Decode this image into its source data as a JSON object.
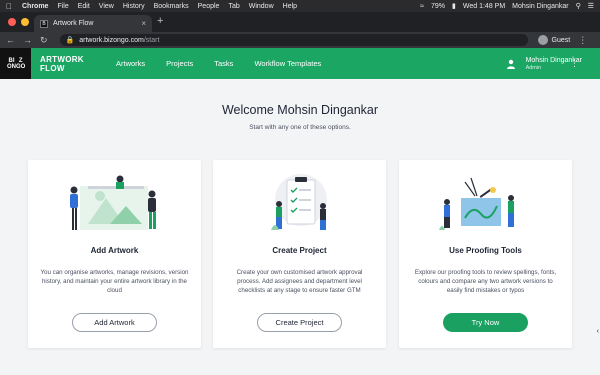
{
  "mac_menu": {
    "app": "Chrome",
    "items": [
      "File",
      "Edit",
      "View",
      "History",
      "Bookmarks",
      "People",
      "Tab",
      "Window",
      "Help"
    ],
    "battery": "79%",
    "clock": "Wed 1:48 PM",
    "user": "Mohsin Dingankar"
  },
  "browser": {
    "tab_title": "Artwork Flow",
    "url_host": "artwork.bizongo.com",
    "url_path": "/start",
    "profile": "Guest"
  },
  "app": {
    "logo_letters": [
      "BI",
      "Z",
      "ON",
      "GO"
    ],
    "name_line1": "ARTWORK",
    "name_line2": "FLOW",
    "nav": [
      "Artworks",
      "Projects",
      "Tasks",
      "Workflow Templates"
    ],
    "user_name": "Mohsin Dingankar",
    "user_role": "Admin",
    "brand_color": "#1ba664"
  },
  "page": {
    "welcome": "Welcome Mohsin Dingankar",
    "subtitle": "Start with any one of these options."
  },
  "cards": [
    {
      "title": "Add Artwork",
      "description": "You can organise artworks, manage revisions, version history, and maintain your entire artwork library in the cloud",
      "button": "Add Artwork",
      "illustration": "artwork-illustration-icon"
    },
    {
      "title": "Create Project",
      "description": "Create your own customised artwork approval process. Add assignees and department level checklists at any stage to ensure faster GTM",
      "button": "Create Project",
      "illustration": "checklist-illustration-icon"
    },
    {
      "title": "Use Proofing Tools",
      "description": "Explore our proofing tools to review spellings, fonts, colours and compare any two artwork versions to easily find mistakes or typos",
      "button": "Try Now",
      "illustration": "proofing-illustration-icon"
    }
  ]
}
